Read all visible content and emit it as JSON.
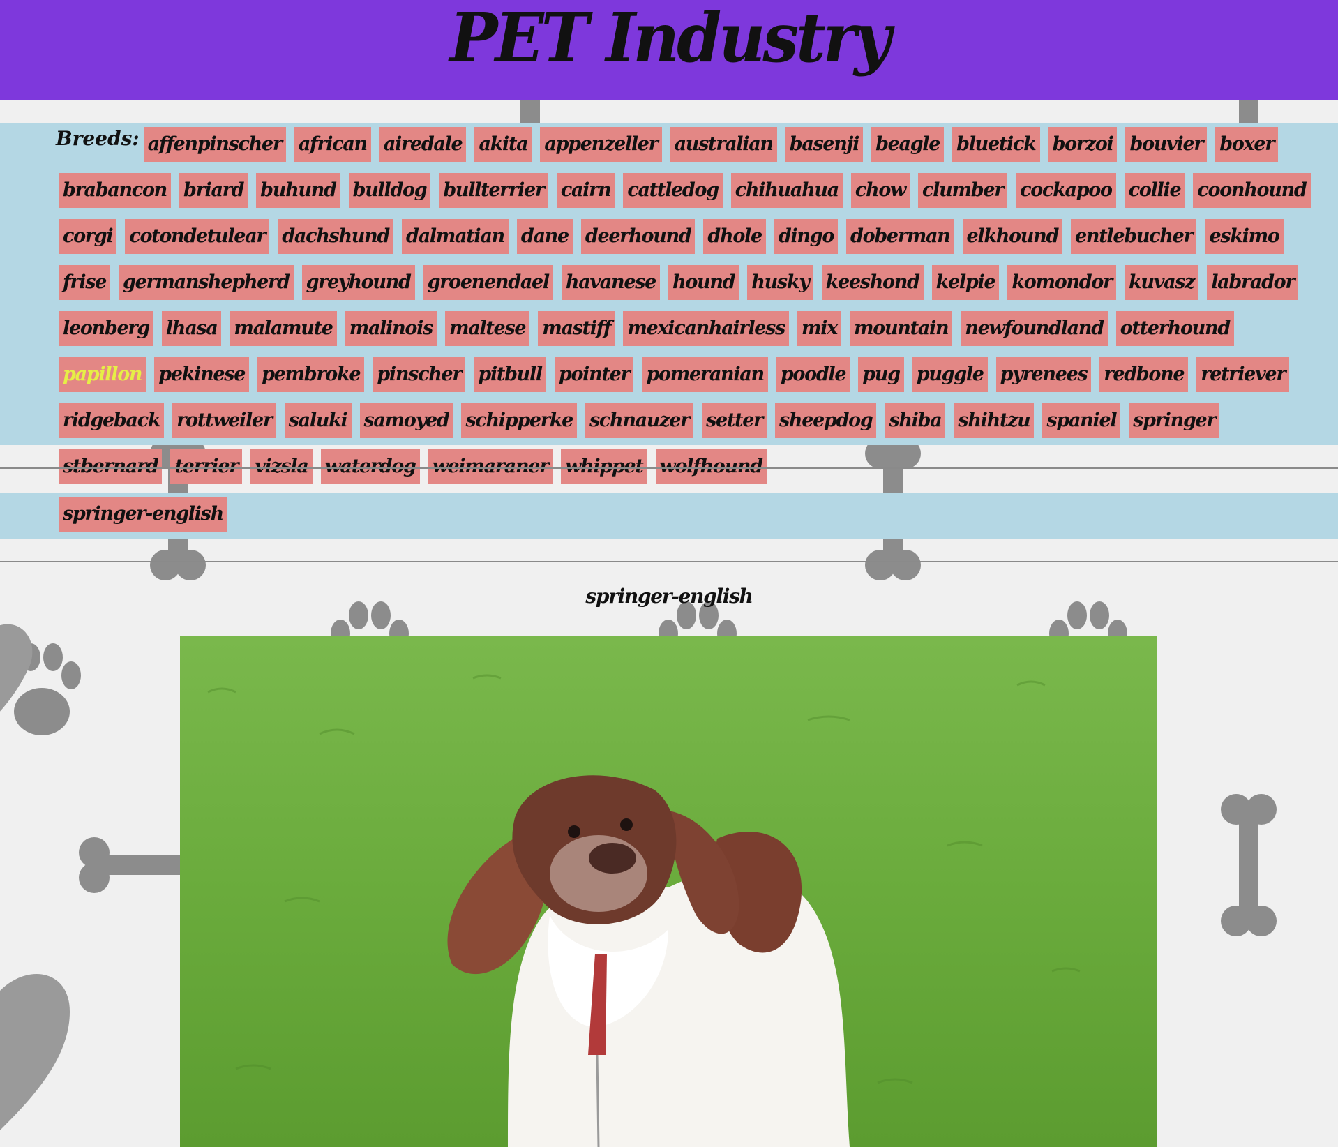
{
  "header": {
    "title": "PET Industry"
  },
  "breeds": {
    "label": "Breeds:",
    "items": [
      "affenpinscher",
      "african",
      "airedale",
      "akita",
      "appenzeller",
      "australian",
      "basenji",
      "beagle",
      "bluetick",
      "borzoi",
      "bouvier",
      "boxer",
      "brabancon",
      "briard",
      "buhund",
      "bulldog",
      "bullterrier",
      "cairn",
      "cattledog",
      "chihuahua",
      "chow",
      "clumber",
      "cockapoo",
      "collie",
      "coonhound",
      "corgi",
      "cotondetulear",
      "dachshund",
      "dalmatian",
      "dane",
      "deerhound",
      "dhole",
      "dingo",
      "doberman",
      "elkhound",
      "entlebucher",
      "eskimo",
      "frise",
      "germanshepherd",
      "greyhound",
      "groenendael",
      "havanese",
      "hound",
      "husky",
      "keeshond",
      "kelpie",
      "komondor",
      "kuvasz",
      "labrador",
      "leonberg",
      "lhasa",
      "malamute",
      "malinois",
      "maltese",
      "mastiff",
      "mexicanhairless",
      "mix",
      "mountain",
      "newfoundland",
      "otterhound",
      "papillon",
      "pekinese",
      "pembroke",
      "pinscher",
      "pitbull",
      "pointer",
      "pomeranian",
      "poodle",
      "pug",
      "puggle",
      "pyrenees",
      "redbone",
      "retriever",
      "ridgeback",
      "rottweiler",
      "saluki",
      "samoyed",
      "schipperke",
      "schnauzer",
      "setter",
      "sheepdog",
      "shiba",
      "shihtzu",
      "spaniel",
      "springer",
      "stbernard",
      "terrier",
      "vizsla",
      "waterdog",
      "weimaraner",
      "whippet",
      "wolfhound"
    ],
    "active": "papillon"
  },
  "sub_breeds": {
    "items": [
      "springer-english"
    ]
  },
  "result": {
    "title": "springer-english",
    "image": "springer-spaniel-dog-photo"
  },
  "colors": {
    "header_bg": "#7e38dc",
    "panel_bg": "#b4d7e4",
    "chip_bg": "#e38785",
    "chip_active_text": "#e6ef46",
    "text": "#111111"
  }
}
